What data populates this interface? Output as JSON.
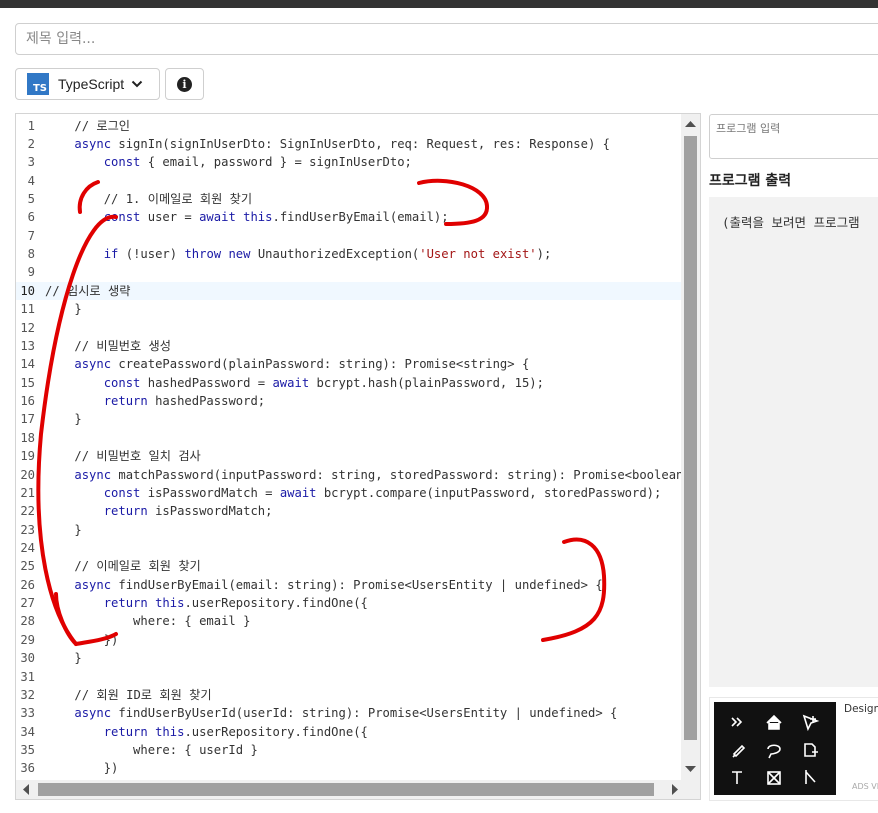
{
  "title_input": {
    "placeholder": "제목 입력..."
  },
  "language": {
    "label": "TypeScript",
    "badge": "TS"
  },
  "info_button": {
    "glyph": "i"
  },
  "editor": {
    "active_line": 10,
    "lines": [
      "    // 로그인",
      "    async signIn(signInUserDto: SignInUserDto, req: Request, res: Response) {",
      "        const { email, password } = signInUserDto;",
      "",
      "        // 1. 이메일로 회원 찾기",
      "        const user = await this.findUserByEmail(email);",
      "",
      "        if (!user) throw new UnauthorizedException('User not exist');",
      "",
      "// 임시로 생략",
      "    }",
      "",
      "    // 비밀번호 생성",
      "    async createPassword(plainPassword: string): Promise<string> {",
      "        const hashedPassword = await bcrypt.hash(plainPassword, 15);",
      "        return hashedPassword;",
      "    }",
      "",
      "    // 비밀번호 일치 검사",
      "    async matchPassword(inputPassword: string, storedPassword: string): Promise<boolean> {",
      "        const isPasswordMatch = await bcrypt.compare(inputPassword, storedPassword);",
      "        return isPasswordMatch;",
      "    }",
      "",
      "    // 이메일로 회원 찾기",
      "    async findUserByEmail(email: string): Promise<UsersEntity | undefined> {",
      "        return this.userRepository.findOne({",
      "            where: { email }",
      "        })",
      "    }",
      "",
      "    // 회원 ID로 회원 찾기",
      "    async findUserByUserId(userId: string): Promise<UsersEntity | undefined> {",
      "        return this.userRepository.findOne({",
      "            where: { userId }",
      "        })"
    ]
  },
  "program_input": {
    "placeholder": "프로그램 입력"
  },
  "output": {
    "title": "프로그램 출력",
    "text": "(출력을 보려면 프로그램"
  },
  "ad": {
    "design_label": "Design",
    "via_label": "ADS VI"
  },
  "colors": {
    "keyword": "#1a1aa6",
    "string": "#a31515",
    "annotation": "#e00000",
    "ts_brand": "#3178c6"
  }
}
